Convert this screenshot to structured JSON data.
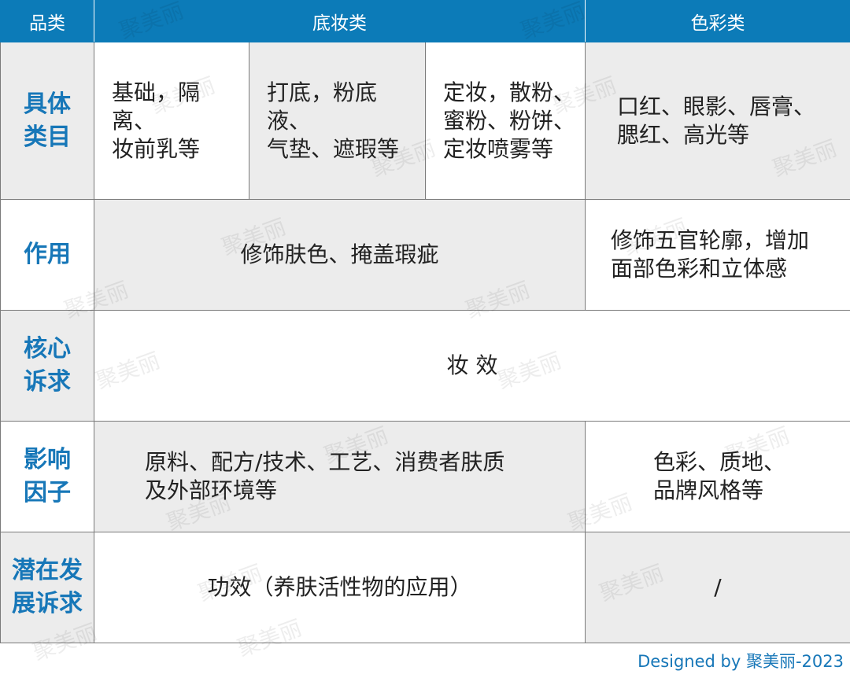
{
  "header": {
    "category": "品类",
    "base_makeup": "底妆类",
    "color_makeup": "色彩类"
  },
  "rows": {
    "specific_items": {
      "label": "具体\n类目",
      "base_1": "基础，隔离、\n妆前乳等",
      "base_2": "打底，粉底液、\n气垫、遮瑕等",
      "base_3": "定妆，散粉、\n蜜粉、粉饼、\n定妆喷雾等",
      "color": "口红、眼影、唇膏、\n腮红、高光等"
    },
    "function": {
      "label": "作用",
      "base": "修饰肤色、掩盖瑕疵",
      "color": "修饰五官轮廓，增加\n面部色彩和立体感"
    },
    "core_demand": {
      "label": "核心\n诉求",
      "value": "妆 效"
    },
    "influence_factors": {
      "label": "影响\n因子",
      "base": "原料、配方/技术、工艺、消费者肤质\n及外部环境等",
      "color": "色彩、质地、\n品牌风格等"
    },
    "potential_demand": {
      "label": "潜在发\n展诉求",
      "base": "功效（养肤活性物的应用）",
      "color": "/"
    }
  },
  "footer": "Designed by 聚美丽-2023",
  "watermark": "聚美丽",
  "colors": {
    "header_bg": "#0c7bb8",
    "label_text": "#1777b8",
    "shade_bg": "#ececec"
  }
}
